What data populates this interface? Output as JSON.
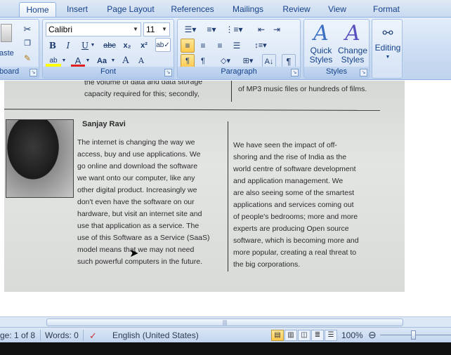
{
  "tabs": [
    {
      "label": "Home",
      "active": true
    },
    {
      "label": "Insert"
    },
    {
      "label": "Page Layout"
    },
    {
      "label": "References"
    },
    {
      "label": "Mailings"
    },
    {
      "label": "Review"
    },
    {
      "label": "View"
    },
    {
      "label": "Format"
    }
  ],
  "clipboard": {
    "label": "board",
    "paste_fragment": "aste"
  },
  "font": {
    "label": "Font",
    "family": "Calibri",
    "size": "11",
    "buttons": [
      "B",
      "I",
      "U",
      "abc",
      "x₂",
      "x²",
      "Aa",
      "A",
      "A",
      "A"
    ]
  },
  "paragraph": {
    "label": "Paragraph"
  },
  "styles": {
    "label": "Styles",
    "quick": "Quick\nStyles",
    "change": "Change\nStyles"
  },
  "editing": {
    "label": "Editing"
  },
  "document": {
    "top_left_1": "the volume of data and data storage",
    "top_left_2": "capacity required for this; secondly,",
    "top_right": "of MP3 music files or hundreds of films.",
    "author": "Sanjay Ravi",
    "left_col": [
      "The internet is changing the way we",
      "access, buy and use applications. We",
      "go online and download the software",
      "we want onto our computer, like any",
      "other digital product. Increasingly we",
      "don't even have the software on our",
      "hardware, but visit an internet site and",
      "use that application as a service. The",
      "use of this Software as a Service (SaaS)",
      "model means that we may not need",
      "such powerful computers in the future."
    ],
    "right_col": [
      "We have seen the impact of off-",
      "shoring and the rise of India as the",
      "world centre of software development",
      "and application management. We",
      "are also seeing some of the smartest",
      "applications and services coming out",
      "of people's bedrooms; more and more",
      "experts are producing Open source",
      "software, which is becoming more and",
      "more popular, creating a real threat to",
      "the big corporations."
    ]
  },
  "status": {
    "page": "ge: 1 of 8",
    "words": "Words: 0",
    "language": "English (United States)",
    "zoom": "100%"
  }
}
